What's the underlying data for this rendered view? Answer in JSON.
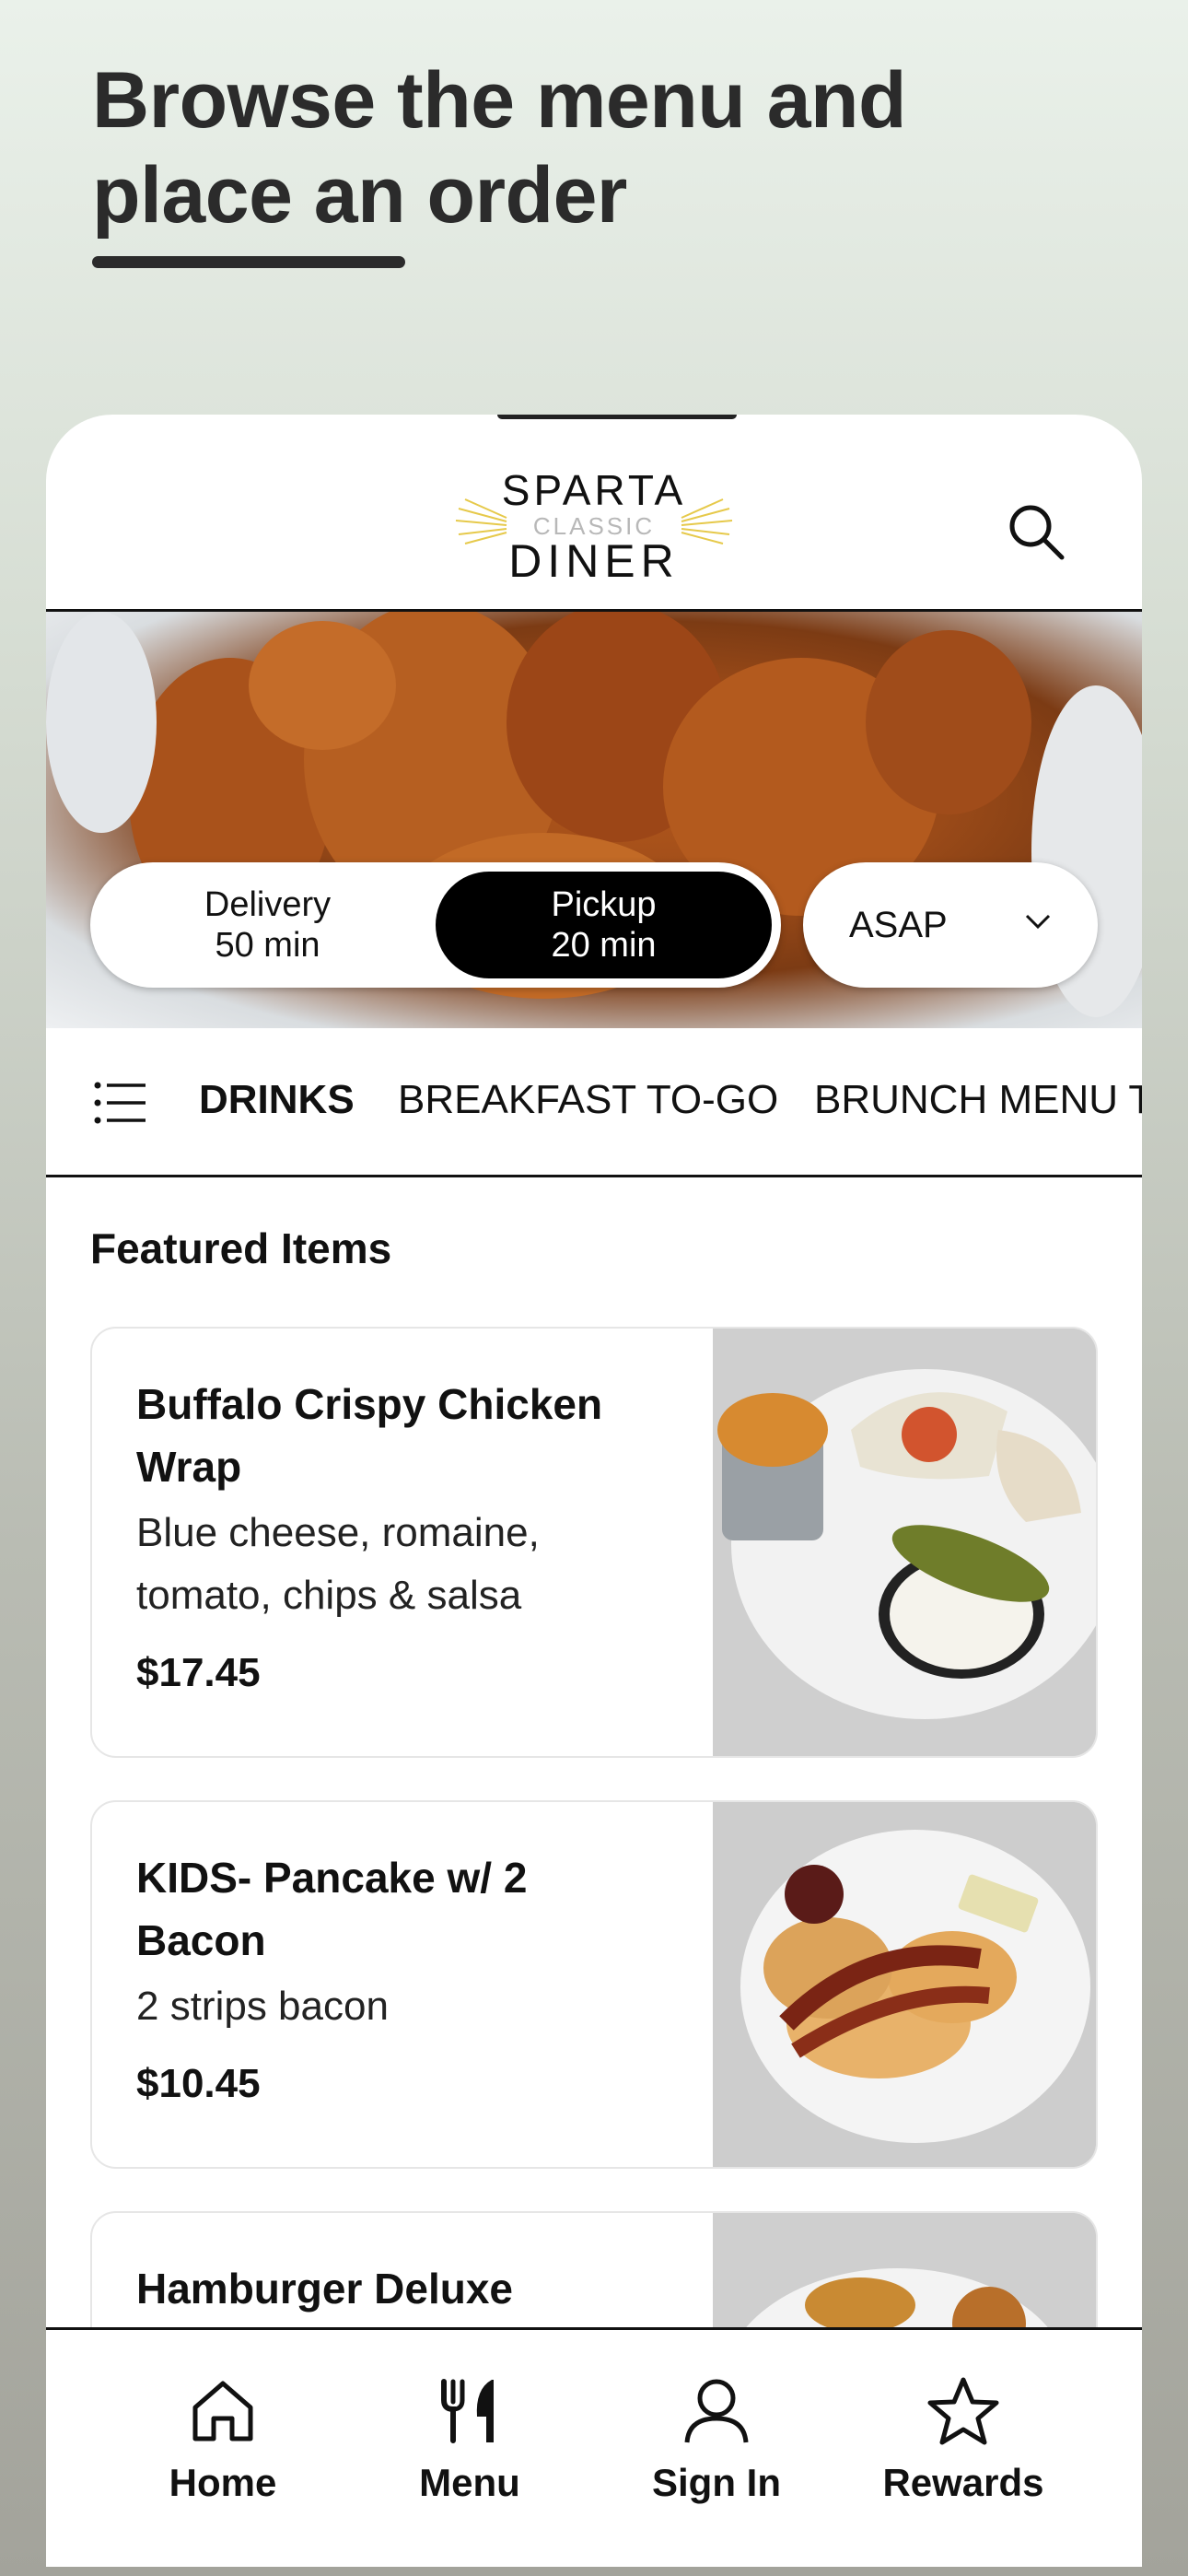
{
  "promo": {
    "headline_line1": "Browse the menu and",
    "headline_line2": "place an order"
  },
  "brand": {
    "logo_top": "SPARTA",
    "logo_middle": "CLASSIC",
    "logo_bottom": "DINER",
    "accent_color": "#e6c94a"
  },
  "order_mode": {
    "delivery_label": "Delivery",
    "delivery_time": "50 min",
    "pickup_label": "Pickup",
    "pickup_time": "20 min",
    "selected": "pickup",
    "schedule_value": "ASAP"
  },
  "categories": [
    "DRINKS",
    "BREAKFAST TO-GO",
    "BRUNCH MENU T"
  ],
  "active_category": "DRINKS",
  "featured": {
    "title": "Featured Items",
    "items": [
      {
        "name_line1": "Buffalo Crispy Chicken",
        "name_line2": "Wrap",
        "desc_line1": "Blue cheese, romaine,",
        "desc_line2": "tomato, chips & salsa",
        "price": "$17.45"
      },
      {
        "name_line1": "KIDS- Pancake w/ 2",
        "name_line2": "Bacon",
        "desc_line1": "2 strips bacon",
        "price": "$10.45"
      },
      {
        "name_line1": "Hamburger Deluxe"
      }
    ]
  },
  "nav": [
    {
      "label": "Home",
      "icon": "home-icon"
    },
    {
      "label": "Menu",
      "icon": "fork-knife-icon"
    },
    {
      "label": "Sign In",
      "icon": "person-icon"
    },
    {
      "label": "Rewards",
      "icon": "star-icon"
    }
  ]
}
